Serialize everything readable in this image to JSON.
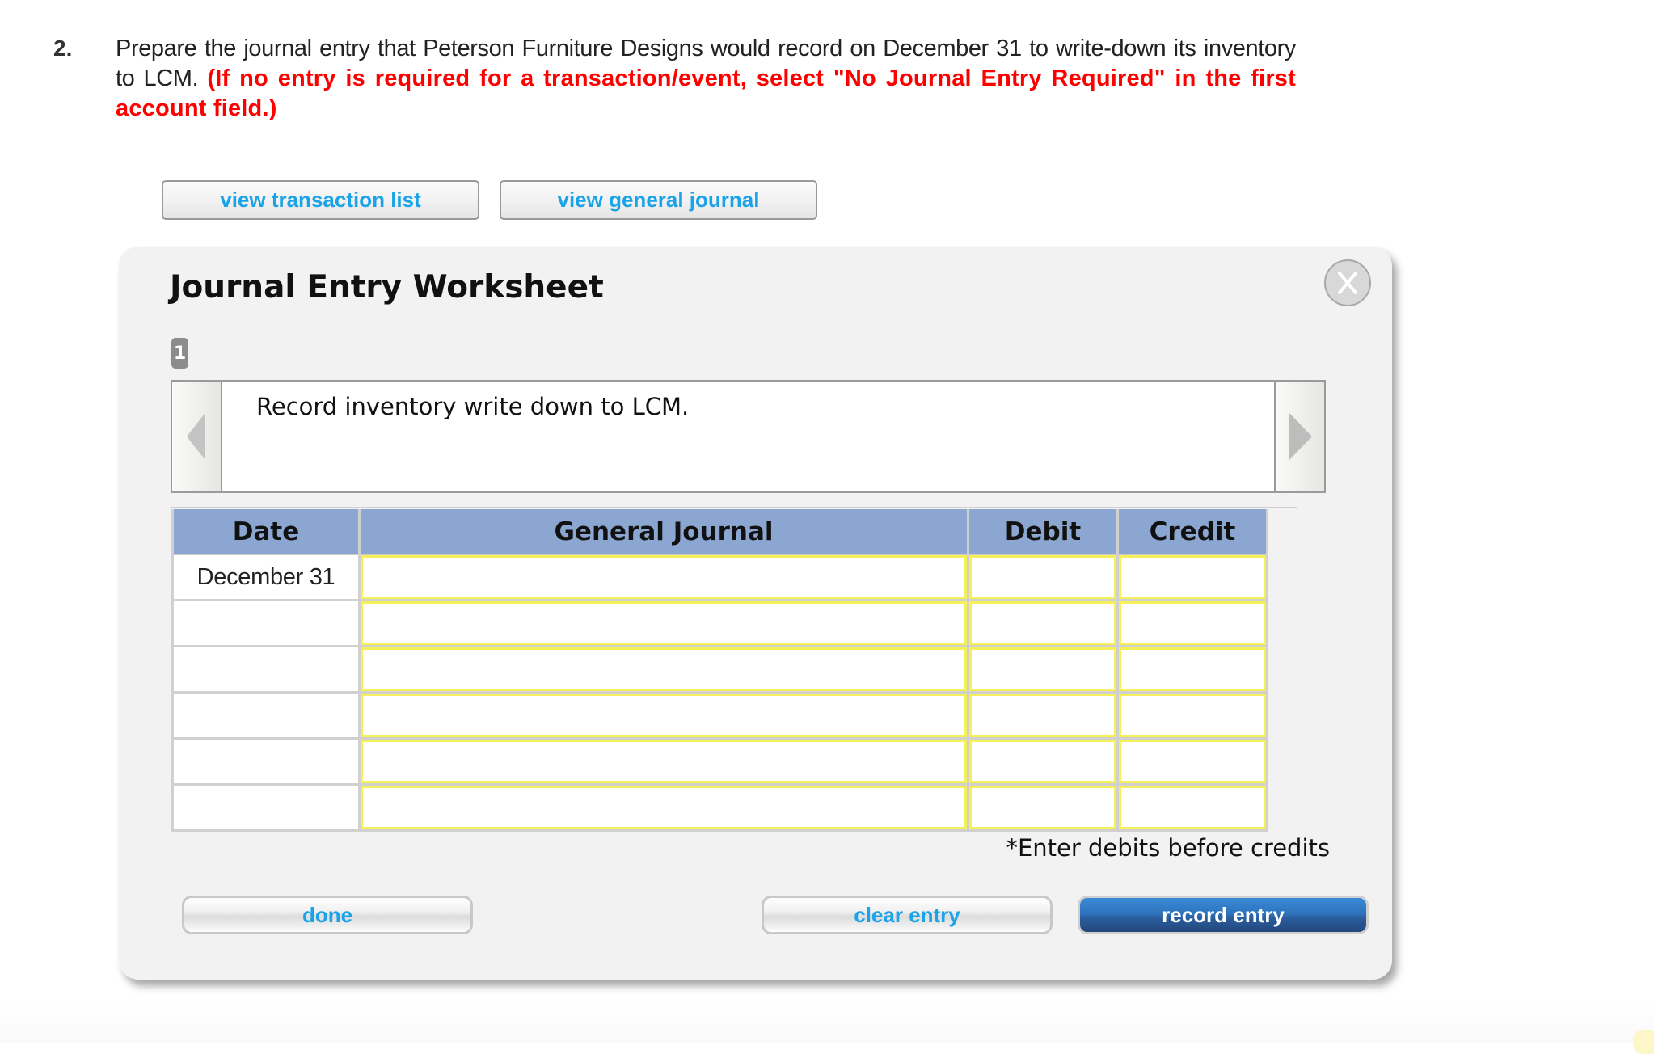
{
  "question": {
    "number": "2.",
    "text": "Prepare the journal entry that Peterson Furniture Designs would record on December 31 to write-down its inventory to LCM.",
    "instruction": "(If no entry is required for a transaction/event, select \"No Journal Entry Required\" in the first account field.)"
  },
  "toolbar": {
    "view_transaction_list": "view transaction list",
    "view_general_journal": "view general journal"
  },
  "worksheet": {
    "title": "Journal Entry Worksheet",
    "close_label": "X",
    "transaction_number": "1",
    "description": "Record inventory write down to LCM.",
    "table": {
      "headers": [
        "Date",
        "General Journal",
        "Debit",
        "Credit"
      ],
      "rows": [
        {
          "date": "December 31",
          "account": "",
          "debit": "",
          "credit": ""
        },
        {
          "date": "",
          "account": "",
          "debit": "",
          "credit": ""
        },
        {
          "date": "",
          "account": "",
          "debit": "",
          "credit": ""
        },
        {
          "date": "",
          "account": "",
          "debit": "",
          "credit": ""
        },
        {
          "date": "",
          "account": "",
          "debit": "",
          "credit": ""
        },
        {
          "date": "",
          "account": "",
          "debit": "",
          "credit": ""
        }
      ]
    },
    "note": "*Enter debits before credits",
    "buttons": {
      "done": "done",
      "clear_entry": "clear entry",
      "record_entry": "record entry"
    }
  },
  "colors": {
    "link_blue": "#1aa3e8",
    "instruction_red": "#ff0000",
    "header_blue": "#8aa6d1",
    "input_highlight": "#f5f05a",
    "primary_button": "#2f74bf"
  },
  "icons": {
    "close": "close-circle-x-icon",
    "prev": "triangle-left-icon",
    "next": "triangle-right-icon"
  }
}
